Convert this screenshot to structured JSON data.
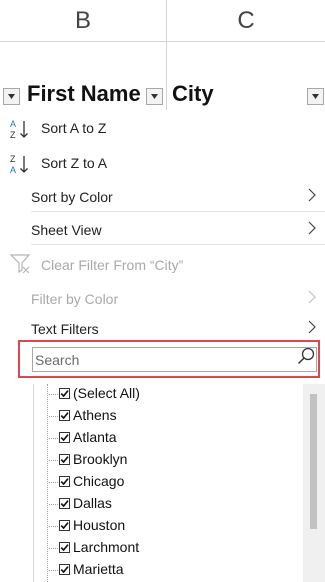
{
  "columns": {
    "b": "B",
    "c": "C"
  },
  "header_cells": {
    "first_name": "First Name",
    "city": "City"
  },
  "menu": {
    "sort_az": "Sort A to Z",
    "sort_za": "Sort Z to A",
    "sort_by_color": "Sort by Color",
    "sheet_view": "Sheet View",
    "clear_filter": "Clear Filter From “City”",
    "filter_by_color": "Filter by Color",
    "text_filters": "Text Filters"
  },
  "sort_icons": {
    "az_top": "A",
    "az_bottom": "Z",
    "za_top": "Z",
    "za_bottom": "A"
  },
  "search": {
    "placeholder": "Search",
    "value": ""
  },
  "list": [
    "(Select All)",
    "Athens",
    "Atlanta",
    "Brooklyn",
    "Chicago",
    "Dallas",
    "Houston",
    "Larchmont",
    "Marietta"
  ],
  "colors": {
    "highlight": "#e0474c",
    "sort_blue": "#2a74c8"
  }
}
